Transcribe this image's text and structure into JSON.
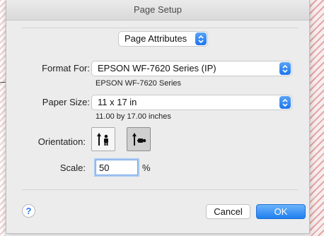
{
  "window": {
    "title": "Page Setup"
  },
  "settings_menu": {
    "selected": "Page Attributes"
  },
  "format_for": {
    "label": "Format For:",
    "selected": "EPSON WF-7620 Series (IP)",
    "sub": "EPSON WF-7620 Series"
  },
  "paper_size": {
    "label": "Paper Size:",
    "selected": "11 x 17 in",
    "sub": "11.00 by 17.00 inches"
  },
  "orientation": {
    "label": "Orientation:",
    "options": [
      "portrait-icon",
      "landscape-icon"
    ],
    "selected": "landscape"
  },
  "scale": {
    "label": "Scale:",
    "value": "50",
    "unit": "%"
  },
  "buttons": {
    "help": "?",
    "cancel": "Cancel",
    "ok": "OK"
  },
  "colors": {
    "accent": "#1f7ff0",
    "background": "#ececec"
  }
}
